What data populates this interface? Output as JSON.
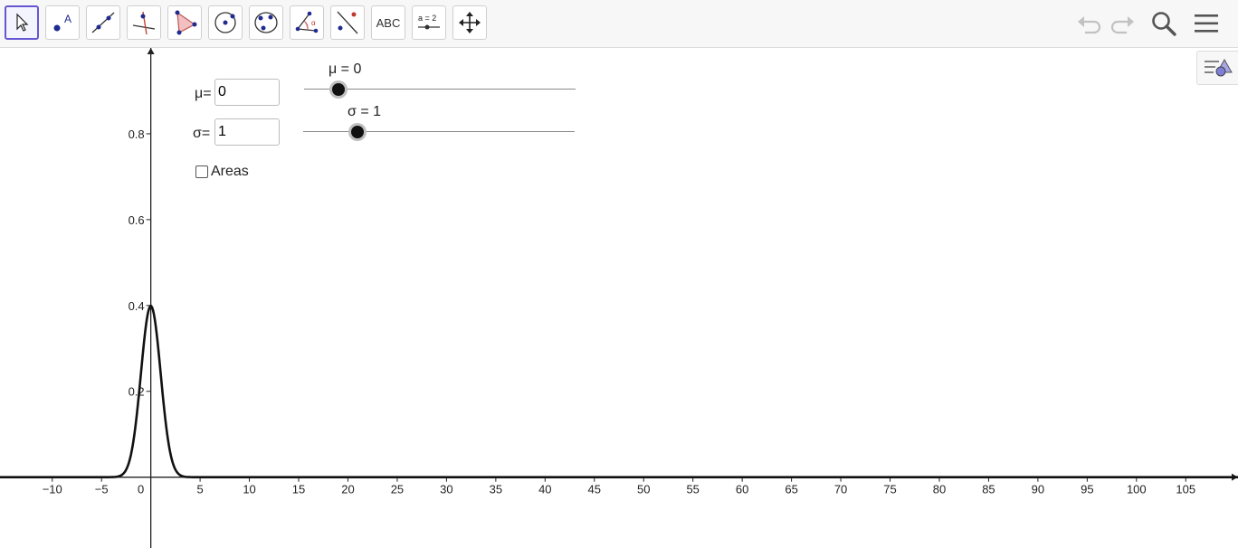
{
  "toolbar": {
    "tools": [
      {
        "name": "move-tool",
        "icon": "cursor-arrow-icon",
        "active": true
      },
      {
        "name": "point-tool",
        "icon": "point-icon"
      },
      {
        "name": "line-tool",
        "icon": "line-icon"
      },
      {
        "name": "perpendicular-line-tool",
        "icon": "perpendicular-icon"
      },
      {
        "name": "polygon-tool",
        "icon": "polygon-icon"
      },
      {
        "name": "circle-tool",
        "icon": "circle-center-icon"
      },
      {
        "name": "conic-tool",
        "icon": "conic-icon"
      },
      {
        "name": "angle-tool",
        "icon": "angle-icon"
      },
      {
        "name": "reflect-tool",
        "icon": "reflect-icon"
      },
      {
        "name": "text-tool",
        "icon": "text-icon",
        "label": "ABC"
      },
      {
        "name": "slider-tool",
        "icon": "slider-icon",
        "label": "a = 2"
      },
      {
        "name": "move-graphics-view-tool",
        "icon": "move-arrows-icon"
      }
    ],
    "right": [
      "undo-icon",
      "redo-icon",
      "search-icon",
      "menu-icon"
    ]
  },
  "controls": {
    "mu_label": "μ=",
    "mu_value": "0",
    "sigma_label": "σ=",
    "sigma_value": "1",
    "areas_label": "Areas",
    "areas_checked": false,
    "mu_slider_caption": "μ = 0",
    "sigma_slider_caption": "σ = 1"
  },
  "chart_data": {
    "type": "line",
    "series": [
      {
        "function": "normal_pdf",
        "mu": 0,
        "sigma": 1
      }
    ],
    "xlim": [
      -15.3,
      110.3
    ],
    "ylim": [
      -0.165,
      1.0
    ],
    "x_ticks": [
      -10,
      -5,
      0,
      5,
      10,
      15,
      20,
      25,
      30,
      35,
      40,
      45,
      50,
      55,
      60,
      65,
      70,
      75,
      80,
      85,
      90,
      95,
      100,
      105
    ],
    "y_ticks": [
      0.2,
      0.4,
      0.6,
      0.8
    ],
    "grid": false
  }
}
